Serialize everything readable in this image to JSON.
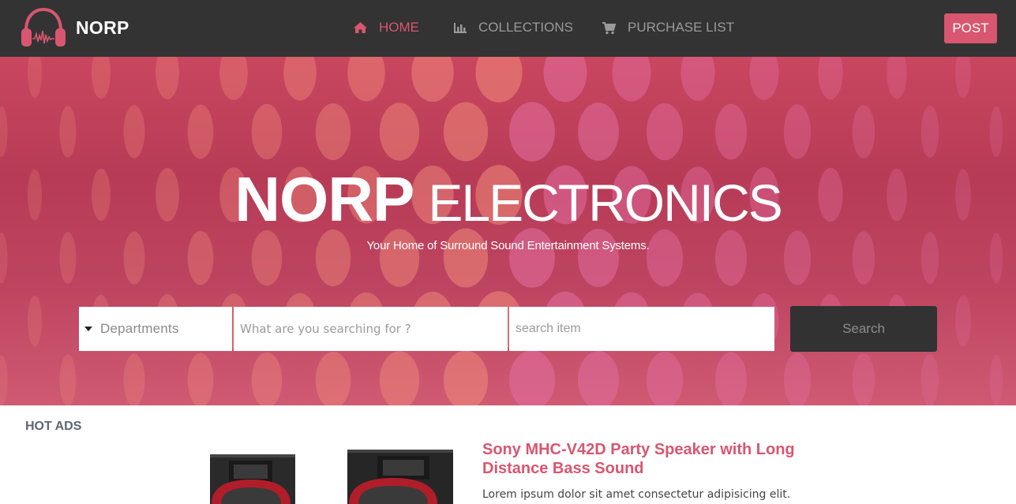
{
  "brand": {
    "name": "NORP",
    "logo_icon": "headphones-icon",
    "accent": "#d8566f"
  },
  "nav": {
    "items": [
      {
        "label": "HOME",
        "icon": "home-icon",
        "active": true
      },
      {
        "label": "COLLECTIONS",
        "icon": "bar-chart-icon",
        "active": false
      },
      {
        "label": "PURCHASE LIST",
        "icon": "cart-icon",
        "active": false
      }
    ],
    "post_label": "POST"
  },
  "hero": {
    "title_strong": "NORP",
    "title_thin": "ELECTRONICS",
    "subtitle": "Your Home of Surround Sound Entertainment Systems."
  },
  "search": {
    "department_label": "Departments",
    "query_placeholder": "What are you searching for ?",
    "item_placeholder": "search item",
    "button_label": "Search"
  },
  "hot_ads": {
    "heading": "HOT ADS",
    "product": {
      "title": "Sony MHC-V42D Party Speaker with Long Distance Bass Sound",
      "description": "Lorem ipsum dolor sit amet consectetur adipisicing elit."
    }
  },
  "colors": {
    "navbar": "#333333",
    "hero": "#c44761",
    "search_button": "#323232"
  }
}
